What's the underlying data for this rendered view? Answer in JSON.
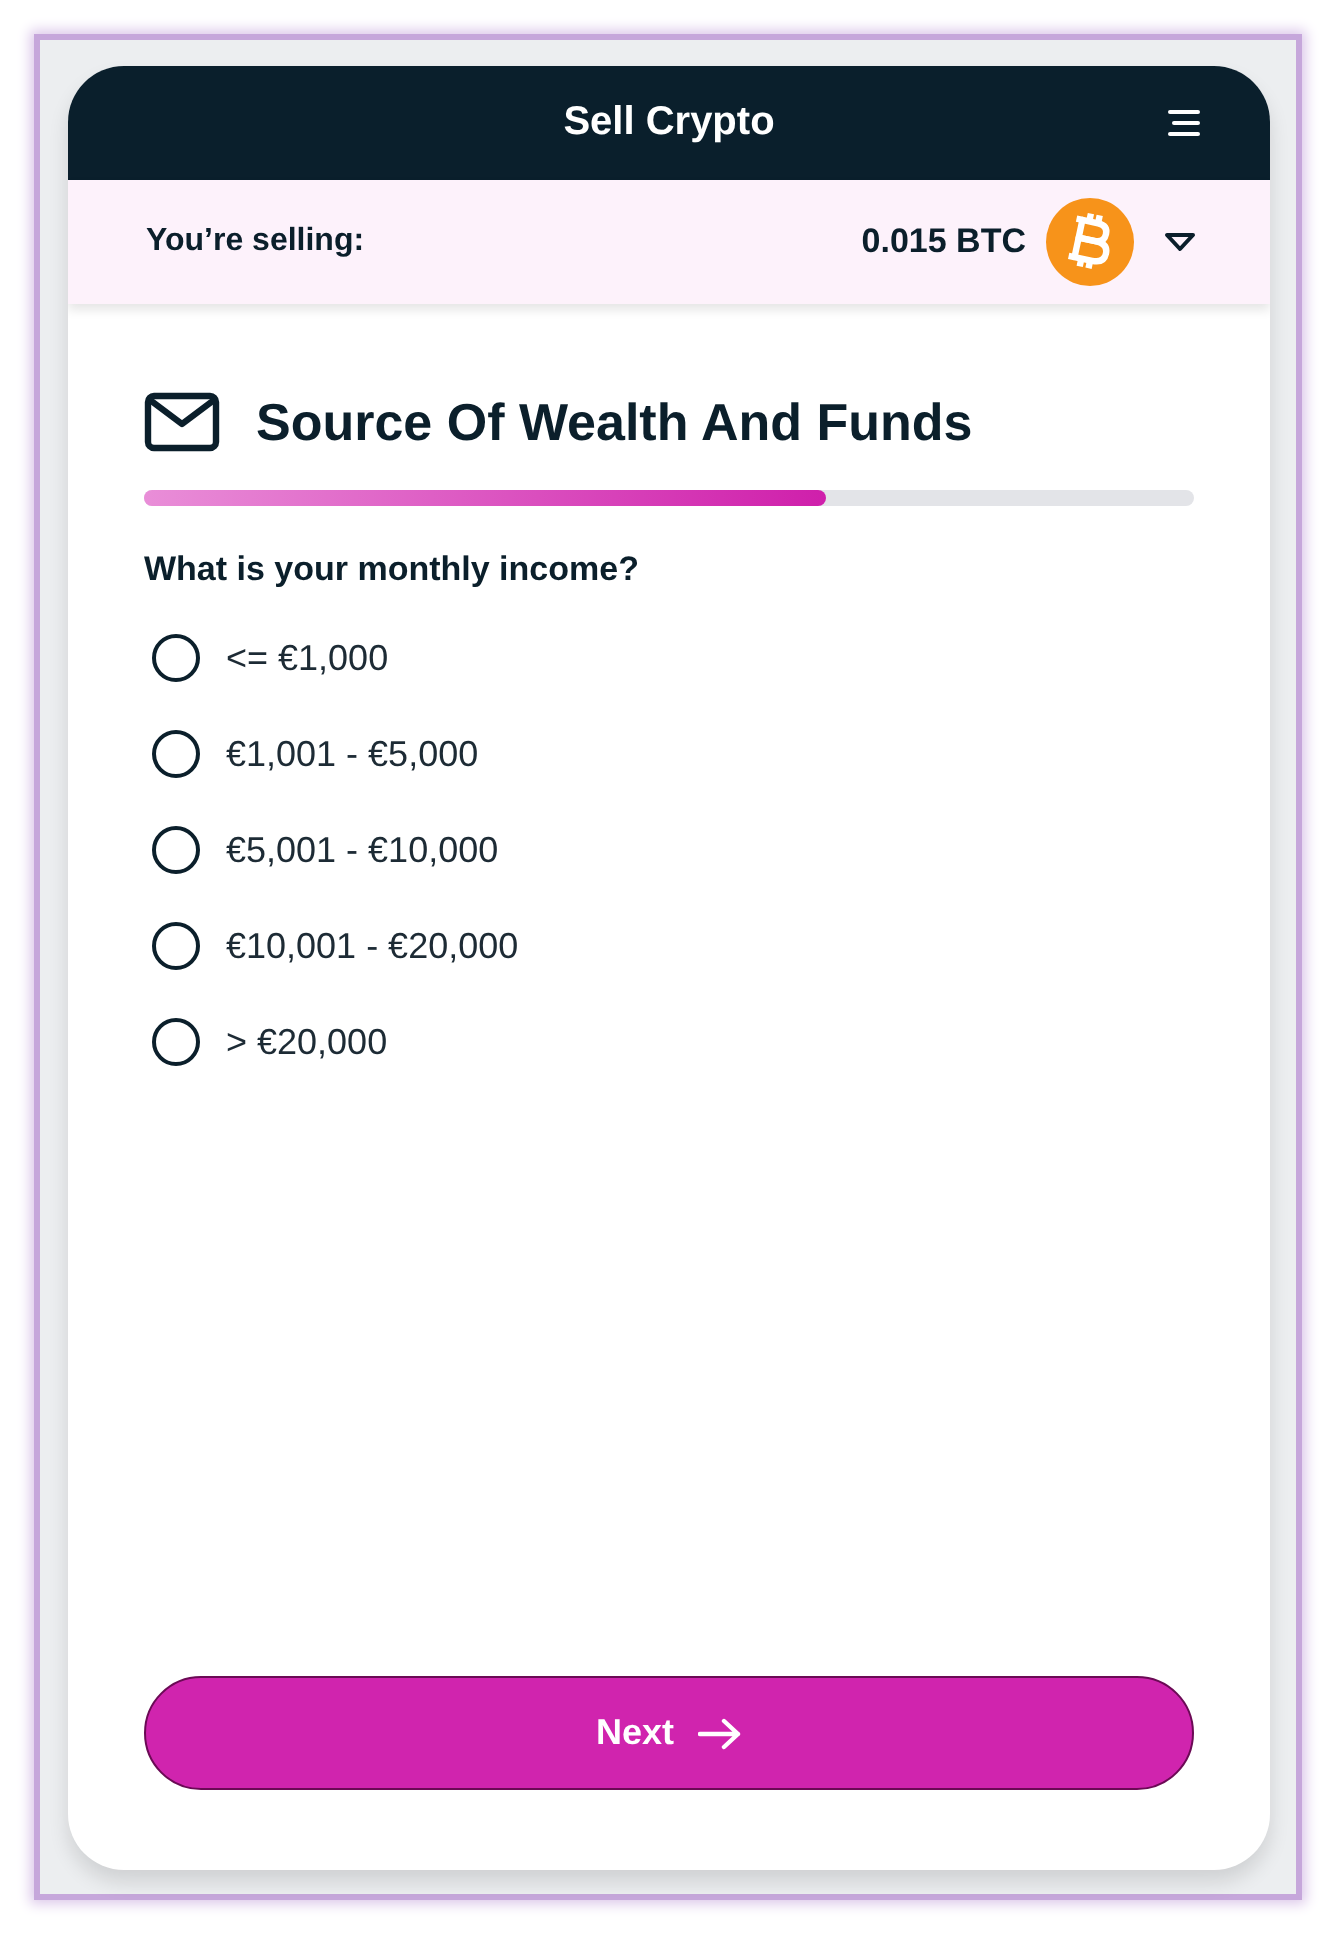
{
  "window": {
    "title": "Sell Crypto"
  },
  "selling": {
    "label": "You’re selling:",
    "amount": "0.015 BTC"
  },
  "section": {
    "title": "Source Of Wealth And Funds",
    "progress": {
      "level": 0.65
    }
  },
  "question": {
    "text": "What is your monthly income?",
    "options": [
      {
        "label": "<= €1,000",
        "selected": false
      },
      {
        "label": "€1,001 - €5,000",
        "selected": false
      },
      {
        "label": "€5,001 - €10,000",
        "selected": false
      },
      {
        "label": "€10,001 - €20,000",
        "selected": false
      },
      {
        "label": "> €20,000",
        "selected": false
      }
    ]
  },
  "buttons": [
    {
      "label": "Next",
      "kind": "primary"
    }
  ]
}
